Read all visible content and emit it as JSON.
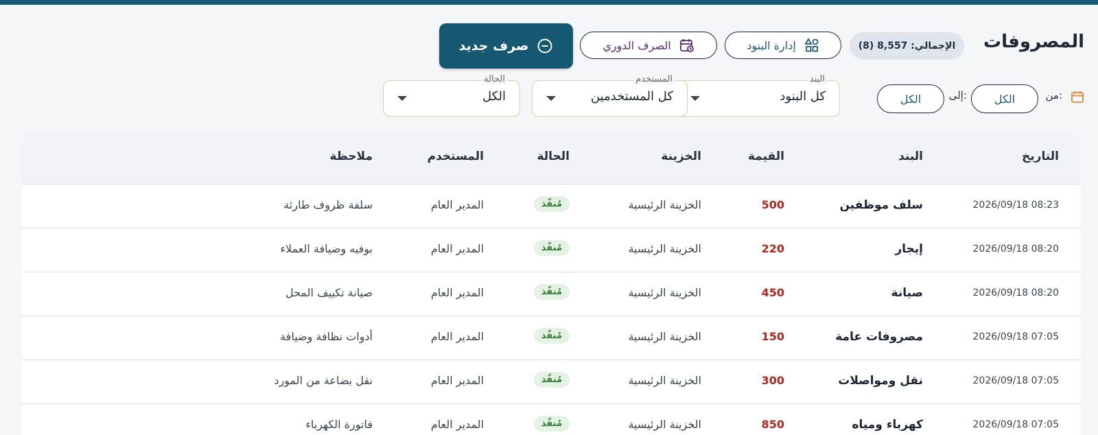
{
  "header": {
    "title": "المصروفات",
    "total_badge": "الإجمالي: 8,557 (8)",
    "manage_items_label": "إدارة البنود",
    "periodic_label": "الصرف الدوري",
    "new_expense_label": "صرف جديد"
  },
  "filters": {
    "from_label": "من:",
    "from_value": "الكل",
    "to_label": "إلى:",
    "to_value": "الكل",
    "item": {
      "legend": "البند",
      "value": "كل البنود"
    },
    "user": {
      "legend": "المستخدم",
      "value": "كل المستخدمين"
    },
    "status": {
      "legend": "الحالة",
      "value": "الكل"
    }
  },
  "table": {
    "columns": {
      "date": "التاريخ",
      "item": "البند",
      "amount": "القيمة",
      "treasury": "الخزينة",
      "status": "الحالة",
      "user": "المستخدم",
      "note": "ملاحظة"
    },
    "rows": [
      {
        "date": "2026/09/18 08:23",
        "item": "سلف موظفين",
        "amount": "500",
        "treasury": "الخزينة الرئيسية",
        "status": "مُنفّذ",
        "user": "المدير العام",
        "note": "سلفة ظروف طارئة"
      },
      {
        "date": "2026/09/18 08:20",
        "item": "إيجار",
        "amount": "220",
        "treasury": "الخزينة الرئيسية",
        "status": "مُنفّذ",
        "user": "المدير العام",
        "note": "بوفيه وضيافة العملاء"
      },
      {
        "date": "2026/09/18 08:20",
        "item": "صيانة",
        "amount": "450",
        "treasury": "الخزينة الرئيسية",
        "status": "مُنفّذ",
        "user": "المدير العام",
        "note": "صيانة تكييف المحل"
      },
      {
        "date": "2026/09/18 07:05",
        "item": "مصروفات عامة",
        "amount": "150",
        "treasury": "الخزينة الرئيسية",
        "status": "مُنفّذ",
        "user": "المدير العام",
        "note": "أدوات نظافة وضيافة"
      },
      {
        "date": "2026/09/18 07:05",
        "item": "نقل ومواصلات",
        "amount": "300",
        "treasury": "الخزينة الرئيسية",
        "status": "مُنفّذ",
        "user": "المدير العام",
        "note": "نقل بضاعة من المورد"
      },
      {
        "date": "2026/09/18 07:05",
        "item": "كهرباء ومياه",
        "amount": "850",
        "treasury": "الخزينة الرئيسية",
        "status": "مُنفّذ",
        "user": "المدير العام",
        "note": "فاتورة الكهرباء"
      }
    ]
  },
  "colors": {
    "accent": "#165872",
    "amount": "#b3261e",
    "status_bg": "#e4f2e5",
    "status_text": "#2e7d32"
  },
  "icons": {
    "manage": "shapes-icon",
    "periodic": "calendar-repeat-icon",
    "new": "minus-circle-icon",
    "date_filter": "calendar-icon"
  }
}
